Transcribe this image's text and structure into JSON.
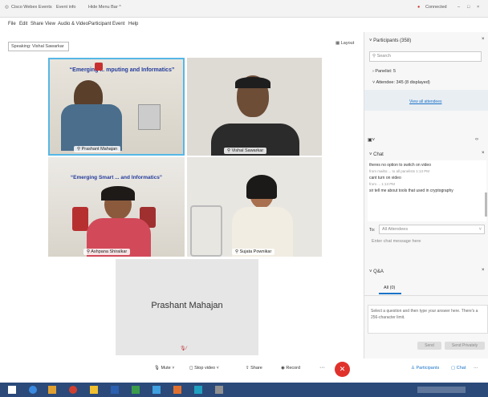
{
  "titlebar": {
    "tabs": [
      "Cisco Webex Events",
      "Event info",
      "Hide Menu Bar ^"
    ],
    "status": "Connected",
    "window_controls": [
      "–",
      "□",
      "×"
    ]
  },
  "menubar": [
    "File",
    "Edit",
    "Share",
    "View",
    "Audio & Video",
    "Participant",
    "Event",
    "Help"
  ],
  "speaking": "Speaking: Vishal Sawarkar",
  "layout_label": "Layout",
  "videos": [
    {
      "name": "Prashant Mahajan",
      "poster_title": "“Emerging ... mputing and Informatics”"
    },
    {
      "name": "Vishal Sawarkar"
    },
    {
      "name": "Ashpana Shiralkar",
      "poster_title": "“Emerging Smart ... and Informatics”"
    },
    {
      "name": "Sujata Pownikar"
    }
  ],
  "main_speaker": "Prashant Mahajan",
  "toolbar": {
    "mute": "Mute",
    "stop_video": "Stop video",
    "share": "Share",
    "record": "Record",
    "more": "···",
    "participants": "Participants",
    "chat": "Chat"
  },
  "participants": {
    "header": "Participants (358)",
    "search_placeholder": "Search",
    "panelists": "Panelist: 5",
    "attendees": "Attendee: 345 (8 displayed)",
    "view_all": "View all attendees"
  },
  "chat": {
    "header": "Chat",
    "messages": [
      {
        "text": "theres no option to switch on video",
        "meta": "from mailto:... to all panelists  1:13 PM"
      },
      {
        "text": "cant turn on video",
        "meta": "from ...  1:13 PM"
      },
      {
        "text": "sir tell me about tools that used in cryptography",
        "meta": ""
      }
    ],
    "to_label": "To:",
    "to_value": "All Attendees",
    "message_placeholder": "Enter chat message here"
  },
  "qa": {
    "header": "Q&A",
    "tab": "All (0)",
    "hint": "Select a question and then type your answer here. There's a 256-character limit.",
    "send": "Send",
    "send_privately": "Send Privately"
  },
  "colors": {
    "accent": "#1a73c8",
    "end_call": "#e0312b",
    "taskbar": "#2b4a7a"
  }
}
